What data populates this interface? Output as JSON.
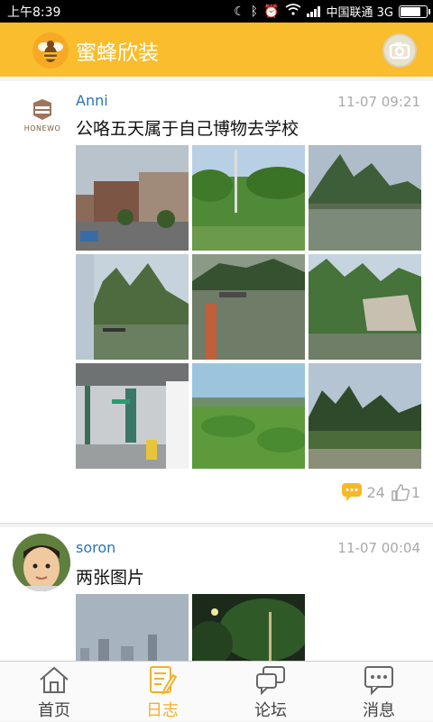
{
  "status_bar": {
    "time": "上午8:39",
    "carrier": "中国联通 3G",
    "battery_level": 0.85
  },
  "header": {
    "app_title": "蜜蜂欣装",
    "logo_icon": "bee-logo-icon",
    "camera_icon": "camera-icon",
    "color": "#f9bd2d"
  },
  "posts": [
    {
      "author": "Anni",
      "avatar_brand": "HONEWO",
      "time": "11-07 09:21",
      "text": "公咯五天属于自己博物去学校",
      "photos": [
        "station-building-photo",
        "roadside-trees-photo",
        "karst-river-photo",
        "karst-cliff-raft-photo",
        "river-raft-photo",
        "karst-cliff-photo",
        "train-platform-photo",
        "green-field-photo",
        "karst-hills-photo"
      ],
      "comments": "24",
      "likes": "1"
    },
    {
      "author": "soron",
      "time": "11-07 00:04",
      "text": "两张图片",
      "photos": [
        "city-skyline-photo",
        "night-trees-photo"
      ]
    }
  ],
  "tabs": [
    {
      "label": "首页",
      "icon": "home-icon",
      "active": false
    },
    {
      "label": "日志",
      "icon": "journal-icon",
      "active": true
    },
    {
      "label": "论坛",
      "icon": "forum-icon",
      "active": false
    },
    {
      "label": "消息",
      "icon": "message-icon",
      "active": false
    }
  ],
  "colors": {
    "accent": "#f9bd2d",
    "author": "#2a73b8",
    "active_tab": "#f2b12b"
  }
}
